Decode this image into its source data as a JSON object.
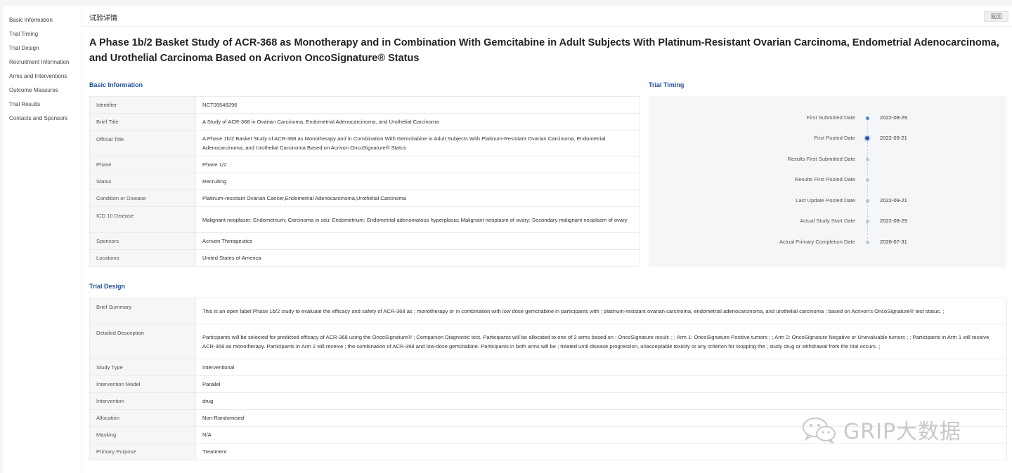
{
  "sidebar": {
    "items": [
      {
        "label": "Basic Information"
      },
      {
        "label": "Trial Timing"
      },
      {
        "label": "Trial Design"
      },
      {
        "label": "Recruitment Information"
      },
      {
        "label": "Arms and Interventions"
      },
      {
        "label": "Outcome Measures"
      },
      {
        "label": "Trial Results"
      },
      {
        "label": "Contacts and Sponsors"
      }
    ]
  },
  "header": {
    "breadcrumb": "试验详情",
    "back_label": "返回"
  },
  "title": "A Phase 1b/2 Basket Study of ACR-368 as Monotherapy and in Combination With Gemcitabine in Adult Subjects With Platinum-Resistant Ovarian Carcinoma, Endometrial Adenocarcinoma, and Urothelial Carcinoma Based on Acrivon OncoSignature® Status",
  "basic_info": {
    "section_title": "Basic Information",
    "rows": [
      {
        "key": "Identifier",
        "value": "NCT05548296"
      },
      {
        "key": "Brief Title",
        "value": "A Study of ACR-368 in Ovarian Carcinoma, Endometrial Adenocarcinoma, and Urothelial Carcinoma"
      },
      {
        "key": "Official Title",
        "value": "A Phase 1b/2 Basket Study of ACR-368 as Monotherapy and in Combination With Gemcitabine in Adult Subjects With Platinum-Resistant Ovarian Carcinoma, Endometrial Adenocarcinoma, and Urothelial Carcinoma Based on Acrivon OncoSignature® Status"
      },
      {
        "key": "Phase",
        "value": "Phase 1/2"
      },
      {
        "key": "Status",
        "value": "Recruiting"
      },
      {
        "key": "Condition or Disease",
        "value": "Platinum-resistant Ovarian Cancer,Endometrial Adenocarcinoma,Urothelial Carcinoma"
      },
      {
        "key": "ICD 10 Disease",
        "value": "Malignant neoplasm: Endometrium; Carcinoma in situ: Endometrium; Endometrial adenomatous hyperplasia; Malignant neoplasm of ovary; Secondary malignant neoplasm of ovary"
      },
      {
        "key": "Sponsors",
        "value": "Acrivon Therapeutics"
      },
      {
        "key": "Locations",
        "value": "United States of America"
      }
    ]
  },
  "trial_timing": {
    "section_title": "Trial Timing",
    "events": [
      {
        "label": "First Submitted Date",
        "date": "2022-08-29"
      },
      {
        "label": "First Posted Date",
        "date": "2022-09-21"
      },
      {
        "label": "Results First Submitted Date",
        "date": ""
      },
      {
        "label": "Results First Posted Date",
        "date": ""
      },
      {
        "label": "Last Update Posted Date",
        "date": "2022-09-21"
      },
      {
        "label": "Actual Study Start Date",
        "date": "2022-08-29"
      },
      {
        "label": "Actual Primary Completion Date",
        "date": "2026-07-31"
      }
    ]
  },
  "trial_design": {
    "section_title": "Trial Design",
    "rows": [
      {
        "key": "Brief Summary",
        "value": "This is an open label Phase 1b/2 study to evaluate the efficacy and safety of ACR-368 as ; monotherapy or in combination with low dose gemcitabine in participants with ; platinum-resistant ovarian carcinoma, endometrial adenocarcinoma, and urothelial carcinoma ; based on Acrivon's OncoSignature® test status. ;"
      },
      {
        "key": "Detailed Description",
        "value": "Participants will be selected for predicted efficacy of ACR-368 using the OncoSignature® ; Companion Diagnostic test. Participants will be allocated to one of 2 arms based on ; OncoSignature result: ; ; Arm 1: OncoSignature Positive tumors ; ; Arm 2: OncoSignature Negative or Unevaluable tumors ; ; Participants in Arm 1 will receive ACR-368 as monotherapy. Participants in Arm 2 will receive ; the combination of ACR-368 and low-dose gemcitabine. Participants in both arms will be ; treated until disease progression, unacceptable toxicity or any criterion for stopping the ; study drug or withdrawal from the trial occurs. ;"
      },
      {
        "key": "Study Type",
        "value": "Interventional"
      },
      {
        "key": "Intervention Model",
        "value": "Parallel"
      },
      {
        "key": "Intervention",
        "value": "drug"
      },
      {
        "key": "Allocation",
        "value": "Non-Randomised"
      },
      {
        "key": "Masking",
        "value": "N/A"
      },
      {
        "key": "Primary Purpose",
        "value": "Treatment"
      }
    ]
  },
  "watermark": {
    "text": "GRIP大数据",
    "icon": "wechat-icon"
  }
}
